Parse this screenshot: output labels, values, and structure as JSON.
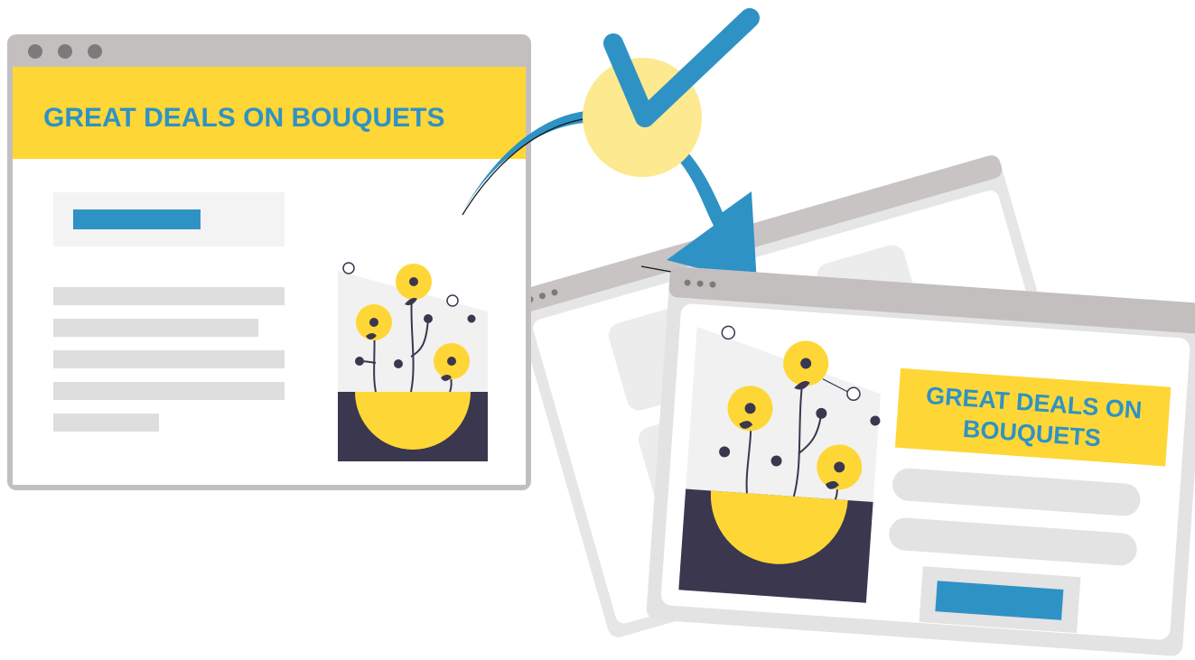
{
  "colors": {
    "accent_yellow": "#fed737",
    "accent_blue": "#2f92c5",
    "frame_gray": "#c4bfbf",
    "placeholder_gray": "#dedede",
    "light_panel": "#f3f3f3",
    "dark_pot": "#3a374f",
    "check_circle": "#fde98f"
  },
  "left_page": {
    "banner_text": "GREAT DEALS ON BOUQUETS"
  },
  "right_page": {
    "banner_line_1": "GREAT DEALS ON",
    "banner_line_2": "BOUQUETS"
  },
  "icons": {
    "check": "checkmark-icon",
    "arrow": "curved-arrow-icon"
  }
}
